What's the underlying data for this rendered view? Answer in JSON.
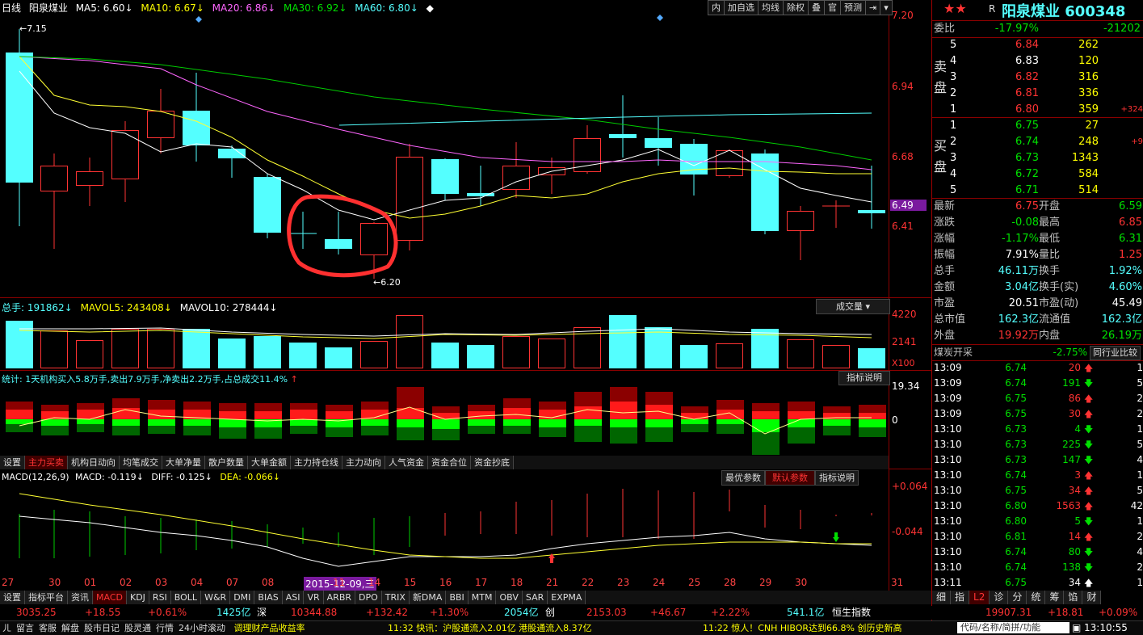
{
  "header": {
    "period": "日线",
    "stock": "阳泉煤业",
    "ma5": "MA5: 6.60",
    "ma10": "MA10: 6.67",
    "ma20": "MA20: 6.86",
    "ma30": "MA30: 6.92",
    "ma60": "MA60: 6.80",
    "buttons": [
      "内",
      "加自选",
      "均线",
      "除权",
      "叠",
      "官",
      "预测"
    ]
  },
  "price_axis": [
    "7.20",
    "6.94",
    "6.68",
    "6.49",
    "6.41"
  ],
  "high_label": "7.15",
  "low_label": "6.20",
  "vol_header": {
    "total": "总手: 191862",
    "mavol5": "MAVOL5: 243408",
    "mavol10": "MAVOL10: 278444",
    "dropdown": "成交量"
  },
  "vol_axis": [
    "4220",
    "2141",
    "X100"
  ],
  "stat_header": {
    "text": "统计: 1天机构买入5.8万手,卖出7.9万手,净卖出2.2万手,占总成交11.4%",
    "btn": "指标说明"
  },
  "stat_axis": [
    "19.34",
    "0"
  ],
  "tabs1": [
    "设置",
    "主力买卖",
    "机构日动向",
    "均笔成交",
    "大单净量",
    "散户数量",
    "大单金额",
    "主力持仓线",
    "主力动向",
    "人气资金",
    "资金合位",
    "资金抄底"
  ],
  "macd_header": {
    "text": "MACD(12,26,9)",
    "macd": "MACD: -0.119",
    "diff": "DIFF: -0.125",
    "dea": "DEA: -0.066",
    "b1": "最优参数",
    "b2": "默认参数",
    "b3": "指标说明"
  },
  "macd_axis": [
    "+0.064",
    "-0.044"
  ],
  "dates": [
    "27",
    "30",
    "01",
    "02",
    "03",
    "04",
    "07",
    "08",
    "2015-12-09,三",
    "11",
    "14",
    "15",
    "16",
    "17",
    "18",
    "21",
    "22",
    "23",
    "24",
    "25",
    "28",
    "29",
    "30",
    "31"
  ],
  "tabs2": [
    "设置",
    "指标平台",
    "资讯",
    "MACD",
    "KDJ",
    "RSI",
    "BOLL",
    "W&R",
    "DMI",
    "BIAS",
    "ASI",
    "VR",
    "ARBR",
    "DPO",
    "TRIX",
    "新DMA",
    "BBI",
    "MTM",
    "OBV",
    "SAR",
    "EXPMA"
  ],
  "status1": {
    "i1": "3035.25",
    "i2": "+18.55",
    "i3": "+0.61%",
    "i4": "1425亿",
    "i5": "深",
    "i6": "10344.88",
    "i7": "+132.42",
    "i8": "+1.30%",
    "i9": "2054亿",
    "i10": "创",
    "i11": "2153.03",
    "i12": "+46.67",
    "i13": "+2.22%",
    "i14": "541.1亿",
    "i15": "恒生指数",
    "i16": "19907.31",
    "i17": "+18.81",
    "i18": "+0.09%"
  },
  "status2": {
    "a": "ㄦ",
    "b": "留言",
    "c": "客服",
    "d": "解盘",
    "e": "股市日记",
    "f": "股灵通",
    "g": "行情",
    "h": "24小时滚动",
    "news1": "调理财产品收益率",
    "news2": "11:32 快讯：沪股通流入2.01亿 港股通流入8.37亿",
    "news3": "11:22 惊人！CNH HIBOR达到66.8% 创历史新高",
    "search": "代码/名称/简拼/功能",
    "time": "13:10:55"
  },
  "panel": {
    "title": "阳泉煤业 600348",
    "r": "R",
    "weibi": {
      "l": "委比",
      "v1": "-17.97%",
      "v2": "-21202"
    },
    "sell": [
      [
        "5",
        "6.84",
        "262",
        ""
      ],
      [
        "4",
        "6.83",
        "120",
        ""
      ],
      [
        "3",
        "6.82",
        "316",
        ""
      ],
      [
        "2",
        "6.81",
        "336",
        ""
      ],
      [
        "1",
        "6.80",
        "359",
        "+324"
      ]
    ],
    "buy": [
      [
        "1",
        "6.75",
        "27",
        ""
      ],
      [
        "2",
        "6.74",
        "248",
        "+9"
      ],
      [
        "3",
        "6.73",
        "1343",
        ""
      ],
      [
        "4",
        "6.72",
        "584",
        ""
      ],
      [
        "5",
        "6.71",
        "514",
        ""
      ]
    ],
    "sell_label": [
      "卖",
      "盘"
    ],
    "buy_label": [
      "买",
      "盘"
    ],
    "stats": [
      [
        "最新",
        "6.75",
        "开盘",
        "6.59"
      ],
      [
        "涨跌",
        "-0.08",
        "最高",
        "6.85"
      ],
      [
        "涨幅",
        "-1.17%",
        "最低",
        "6.31"
      ],
      [
        "振幅",
        "7.91%",
        "量比",
        "1.25"
      ],
      [
        "总手",
        "46.11万",
        "换手",
        "1.92%"
      ],
      [
        "金额",
        "3.04亿",
        "换手(实)",
        "4.60%"
      ],
      [
        "市盈",
        "20.51",
        "市盈(动)",
        "45.49"
      ],
      [
        "总市值",
        "162.3亿",
        "流通值",
        "162.3亿"
      ],
      [
        "外盘",
        "19.92万",
        "内盘",
        "26.19万"
      ]
    ],
    "sector": {
      "name": "煤炭开采",
      "pct": "-2.75%",
      "btn": "同行业比较"
    },
    "ticks": [
      [
        "13:09",
        "6.74",
        "20",
        "up",
        "1"
      ],
      [
        "13:09",
        "6.74",
        "191",
        "dn",
        "5"
      ],
      [
        "13:09",
        "6.75",
        "86",
        "up",
        "2"
      ],
      [
        "13:09",
        "6.75",
        "30",
        "up",
        "2"
      ],
      [
        "13:10",
        "6.73",
        "4",
        "dn",
        "1"
      ],
      [
        "13:10",
        "6.73",
        "225",
        "dn",
        "5"
      ],
      [
        "13:10",
        "6.73",
        "147",
        "dn",
        "4"
      ],
      [
        "13:10",
        "6.74",
        "3",
        "up",
        "1"
      ],
      [
        "13:10",
        "6.75",
        "34",
        "up",
        "5"
      ],
      [
        "13:10",
        "6.80",
        "1563",
        "up",
        "42"
      ],
      [
        "13:10",
        "6.80",
        "5",
        "dn",
        "1"
      ],
      [
        "13:10",
        "6.81",
        "14",
        "up",
        "2"
      ],
      [
        "13:10",
        "6.74",
        "80",
        "dn",
        "4"
      ],
      [
        "13:10",
        "6.74",
        "138",
        "dn",
        "2"
      ],
      [
        "13:11",
        "6.75",
        "34",
        "wt",
        "1"
      ]
    ],
    "bottom_tabs": [
      "细",
      "指",
      "L2",
      "诊",
      "分",
      "统",
      "筹",
      "馅",
      "财"
    ]
  }
}
